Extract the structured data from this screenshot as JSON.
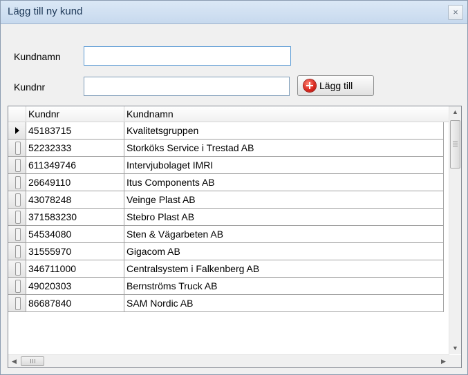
{
  "dialog": {
    "title": "Lägg till ny kund",
    "close_glyph": "×",
    "close_icon": "close-icon"
  },
  "form": {
    "name_label": "Kundnamn",
    "name_value": "",
    "number_label": "Kundnr",
    "number_value": "",
    "add_button_label": "Lägg till",
    "add_button_icon": "add-circle-icon"
  },
  "table": {
    "columns": [
      "Kundnr",
      "Kundnamn"
    ],
    "rows": [
      [
        "45183715",
        "Kvalitetsgruppen"
      ],
      [
        "52232333",
        "Storköks Service i Trestad AB"
      ],
      [
        "611349746",
        "Intervjubolaget IMRI"
      ],
      [
        "26649110",
        "Itus Components AB"
      ],
      [
        "43078248",
        "Veinge Plast AB"
      ],
      [
        "371583230",
        "Stebro Plast AB"
      ],
      [
        "54534080",
        "Sten & Vägarbeten AB"
      ],
      [
        "31555970",
        "Gigacom AB"
      ],
      [
        "346711000",
        "Centralsystem i Falkenberg AB"
      ],
      [
        "49020303",
        "Bernströms Truck AB"
      ],
      [
        "86687840",
        "SAM Nordic AB"
      ]
    ],
    "current_row": 0
  },
  "scrollbars": {
    "up_glyph": "▲",
    "down_glyph": "▼",
    "left_glyph": "◀",
    "right_glyph": "▶"
  }
}
